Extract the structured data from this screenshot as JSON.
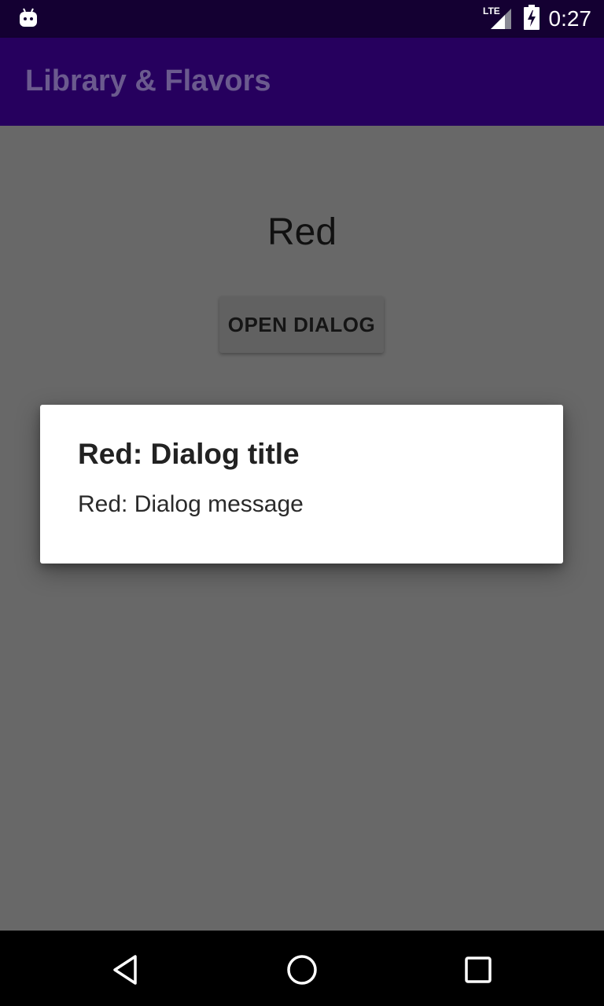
{
  "status_bar": {
    "time": "0:27",
    "network": "LTE"
  },
  "app_bar": {
    "title": "Library & Flavors"
  },
  "main": {
    "flavor_label": "Red",
    "open_dialog_label": "OPEN DIALOG"
  },
  "dialog": {
    "title": "Red: Dialog title",
    "message": "Red: Dialog message"
  },
  "colors": {
    "status_bar": "#140032",
    "app_bar": "#26005e",
    "scrim_background": "#686868",
    "dialog_background": "#ffffff"
  },
  "icons": [
    "android-debug-icon",
    "lte-signal-icon",
    "battery-charging-icon",
    "back-icon",
    "home-icon",
    "recents-icon"
  ]
}
